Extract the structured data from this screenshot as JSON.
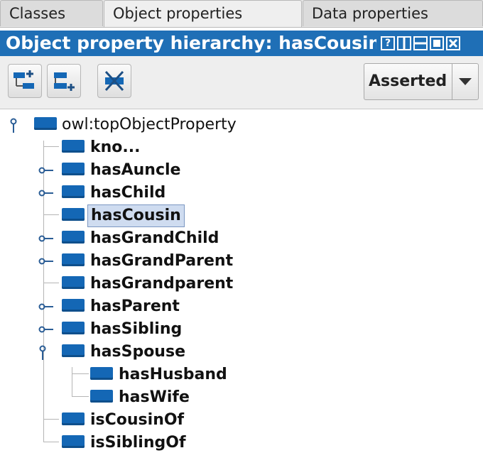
{
  "tabs": [
    {
      "label": "Classes"
    },
    {
      "label": "Object properties"
    },
    {
      "label": "Data properties"
    }
  ],
  "view_title": "Object property hierarchy: hasCousin",
  "title_buttons": [
    "?",
    "split",
    "minimize",
    "maximize",
    "close"
  ],
  "toolbar": {
    "icons": [
      "add-sub-property-icon",
      "add-sibling-property-icon",
      "delete-property-icon"
    ],
    "mode_dropdown": {
      "selected": "Asserted"
    }
  },
  "tree": {
    "root": "owl:topObjectProperty",
    "items": [
      {
        "label": "kno...",
        "expandable": false
      },
      {
        "label": "hasAuncle",
        "expandable": true
      },
      {
        "label": "hasChild",
        "expandable": true
      },
      {
        "label": "hasCousin",
        "expandable": false,
        "selected": true
      },
      {
        "label": "hasGrandChild",
        "expandable": true
      },
      {
        "label": "hasGrandParent",
        "expandable": true
      },
      {
        "label": "hasGrandparent",
        "expandable": false
      },
      {
        "label": "hasParent",
        "expandable": true
      },
      {
        "label": "hasSibling",
        "expandable": true
      },
      {
        "label": "hasSpouse",
        "expandable": true,
        "expanded": true,
        "children": [
          {
            "label": "hasHusband"
          },
          {
            "label": "hasWife"
          }
        ]
      },
      {
        "label": "isCousinOf",
        "expandable": false
      },
      {
        "label": "isSiblingOf",
        "expandable": false
      }
    ]
  },
  "colors": {
    "title_bar": "#1f6fb6",
    "property_icon": "#1467b5",
    "selection": "#cfdcf0",
    "tree_handle": "#2a5d96"
  }
}
